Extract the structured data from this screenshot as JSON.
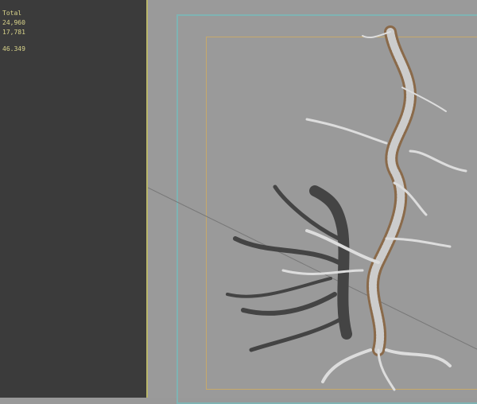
{
  "stats": {
    "header": "Total",
    "polys": "24,960",
    "verts": "17,781",
    "fps": "46.349"
  },
  "colors": {
    "panel": "#3b3b3b",
    "text": "#d8d38a",
    "viewport": "#9a9a9a",
    "safe_frame": "#7fb3b3",
    "render_frame": "#c7a96a"
  }
}
